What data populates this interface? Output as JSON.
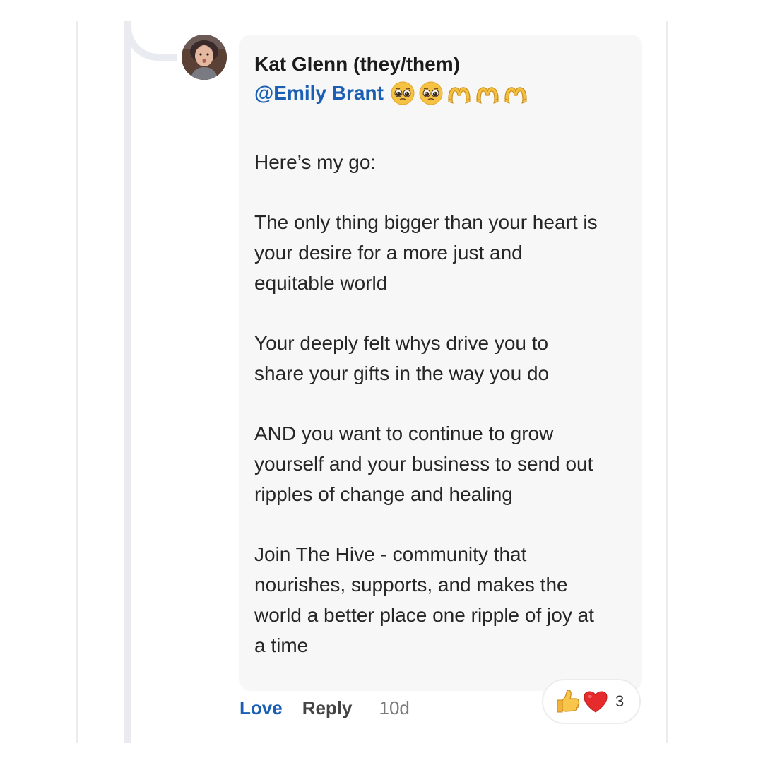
{
  "comment": {
    "author": "Kat Glenn (they/them)",
    "mention": "@Emily Brant",
    "emojis": [
      "pleading-face-icon",
      "pleading-face-icon",
      "heart-hands-icon",
      "heart-hands-icon",
      "heart-hands-icon"
    ],
    "paragraphs": [
      "Here’s my go:",
      "The only thing bigger than your heart is\nyour desire for a more just and\nequitable world",
      "Your deeply felt whys drive you to\nshare your gifts in the way you do",
      "AND you want to continue to grow\nyourself and your business to send out\nripples of change and healing",
      "Join The Hive - community that\nnourishes, supports, and makes the\nworld a better place one ripple of joy at\na time"
    ]
  },
  "actions": {
    "love_label": "Love",
    "reply_label": "Reply",
    "time": "10d"
  },
  "reactions": {
    "icons": [
      "thumbs-up-icon",
      "red-heart-icon"
    ],
    "count": "3"
  },
  "colors": {
    "link": "#1a5fb4",
    "bubble": "#f7f7f7",
    "thread": "#eaebf1"
  }
}
